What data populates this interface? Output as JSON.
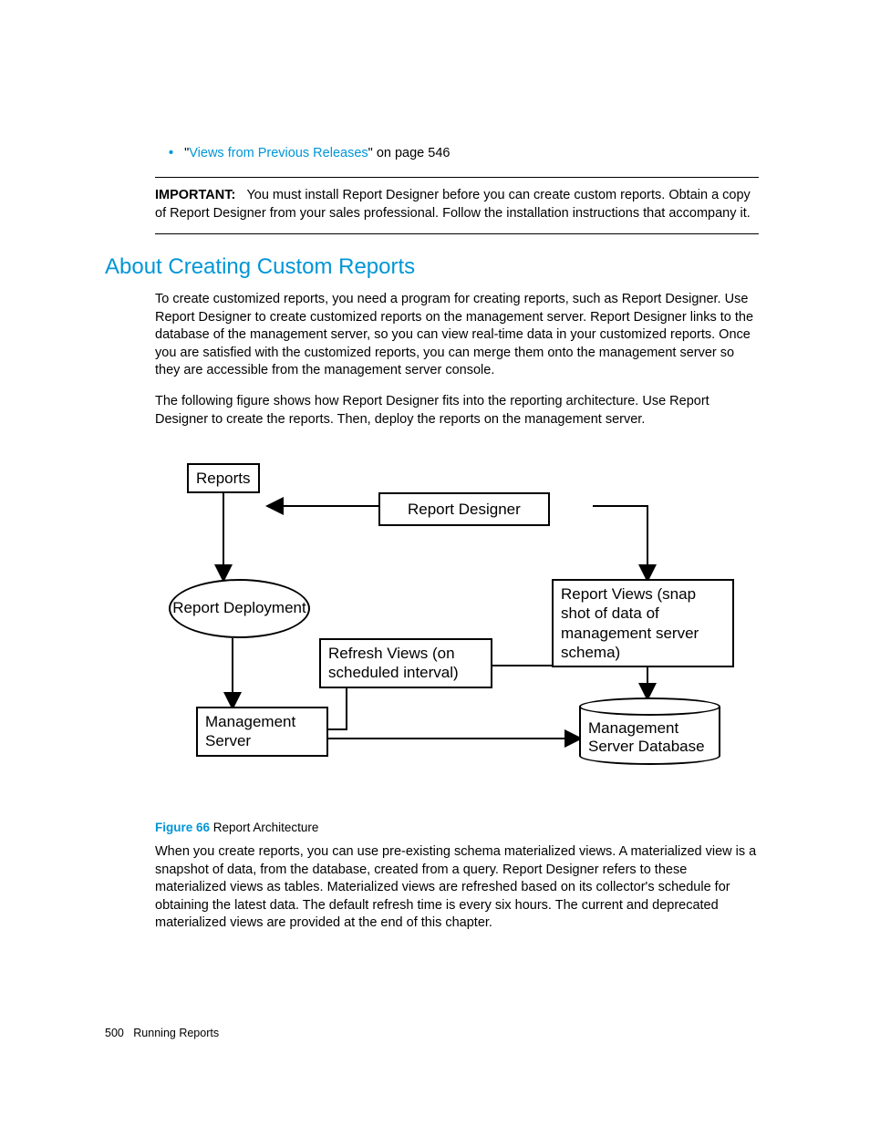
{
  "bullet": {
    "link": "Views from Previous Releases",
    "suffix": "\" on page 546"
  },
  "important": {
    "label": "IMPORTANT:",
    "text": "You must install Report Designer before you can create custom reports. Obtain a copy of Report Designer from your sales professional. Follow the installation instructions that accompany it."
  },
  "heading": "About Creating Custom Reports",
  "para1": "To create customized reports, you need a program for creating reports, such as Report Designer. Use Report Designer to create customized reports on the management server. Report Designer links to the database of the management server, so you can view real-time data in your customized reports. Once you are satisfied with the customized reports, you can merge them onto the management server so they are accessible from the management server console.",
  "para2": "The following figure shows how Report Designer fits into the reporting architecture. Use Report Designer to create the reports. Then, deploy the reports on the management server.",
  "diagram": {
    "reports": "Reports",
    "report_designer": "Report Designer",
    "report_deployment": "Report Deployment",
    "refresh_views": "Refresh Views (on scheduled interval)",
    "report_views": "Report Views (snap shot of data of management server schema)",
    "management_server": "Management Server",
    "management_server_database": "Management Server Database"
  },
  "figure": {
    "label": "Figure 66",
    "caption": "Report Architecture"
  },
  "para3": "When you create reports, you can use pre-existing schema materialized views. A materialized view is a snapshot of data, from the database, created from a query. Report Designer refers to these materialized views as tables. Materialized views are refreshed based on its collector's schedule for obtaining the latest data. The default refresh time is every six hours. The current and deprecated materialized views are provided at the end of this chapter.",
  "footer": {
    "page": "500",
    "section": "Running Reports"
  }
}
